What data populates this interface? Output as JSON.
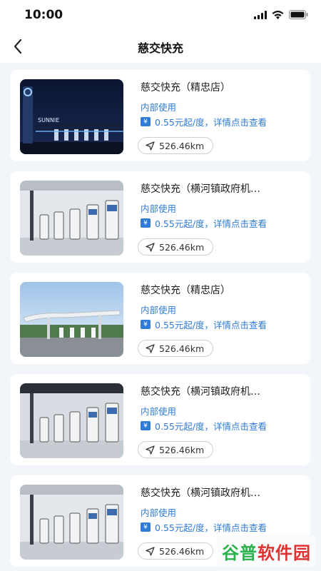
{
  "status_bar": {
    "time": "10:00"
  },
  "header": {
    "title": "慈交快充"
  },
  "stations": [
    {
      "title": "慈交快充（精忠店）",
      "usage": "内部使用",
      "price": "0.55元起/度，详情点击查看",
      "distance": "526.46km",
      "thumb": "night"
    },
    {
      "title": "慈交快充（横河镇政府机…",
      "usage": "内部使用",
      "price": "0.55元起/度，详情点击查看",
      "distance": "526.46km",
      "thumb": "indoor"
    },
    {
      "title": "慈交快充（精忠店）",
      "usage": "内部使用",
      "price": "0.55元起/度，详情点击查看",
      "distance": "526.46km",
      "thumb": "canopy"
    },
    {
      "title": "慈交快充（横河镇政府机…",
      "usage": "内部使用",
      "price": "0.55元起/度，详情点击查看",
      "distance": "526.46km",
      "thumb": "indoor2"
    },
    {
      "title": "慈交快充（横河镇政府机…",
      "usage": "内部使用",
      "price": "0.55元起/度，详情点击查看",
      "distance": "526.46km",
      "thumb": "indoor"
    }
  ],
  "watermark": {
    "part1": "谷普",
    "part2": "软件园"
  },
  "colors": {
    "accent": "#2f7bd6",
    "background": "#f2f5fa"
  }
}
